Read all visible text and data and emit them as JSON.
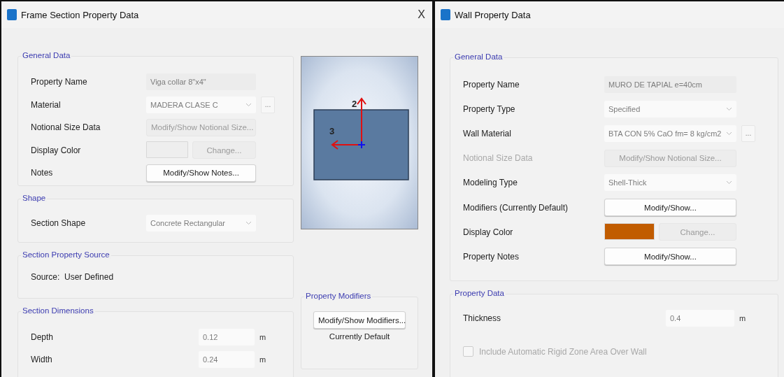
{
  "frame_dialog": {
    "title": "Frame Section Property Data",
    "close": "X",
    "general": {
      "legend": "General Data",
      "rows": [
        {
          "kind": "text",
          "label": "Property Name",
          "value": "Viga collar 8\"x4\"",
          "disabled": true
        },
        {
          "kind": "select",
          "label": "Material",
          "value": "MADERA CLASE C",
          "disabled": true,
          "more": "..."
        },
        {
          "kind": "button",
          "label": "Notional Size Data",
          "value": "Modify/Show Notional Size...",
          "disabled": true
        },
        {
          "kind": "color",
          "label": "Display Color",
          "color": "#eeeeee",
          "value": "Change...",
          "disabled": true
        },
        {
          "kind": "button",
          "label": "Notes",
          "value": "Modify/Show Notes...",
          "disabled": false
        }
      ]
    },
    "shape": {
      "legend": "Shape",
      "rows": [
        {
          "kind": "select",
          "label": "Section Shape",
          "value": "Concrete Rectangular",
          "disabled": true
        }
      ]
    },
    "source": {
      "legend": "Section Property Source",
      "text": "Source:  User Defined"
    },
    "dimensions": {
      "legend": "Section Dimensions",
      "rows": [
        {
          "label": "Depth",
          "value": "0.12",
          "unit": "m"
        },
        {
          "label": "Width",
          "value": "0.24",
          "unit": "m"
        }
      ]
    },
    "preview": {
      "axis_2": "2",
      "axis_3": "3"
    },
    "modifiers": {
      "legend": "Property Modifiers",
      "button": "Modify/Show Modifiers...",
      "status": "Currently Default"
    }
  },
  "wall_dialog": {
    "title": "Wall Property Data",
    "general": {
      "legend": "General Data",
      "rows": [
        {
          "kind": "text",
          "label": "Property Name",
          "value": "MURO DE TAPIAL e=40cm",
          "disabled": true,
          "label_disabled": false
        },
        {
          "kind": "select",
          "label": "Property Type",
          "value": "Specified",
          "disabled": true,
          "label_disabled": false
        },
        {
          "kind": "select",
          "label": "Wall Material",
          "value": "BTA CON 5% CaO fm= 8 kg/cm2",
          "disabled": true,
          "label_disabled": false,
          "more": "..."
        },
        {
          "kind": "button",
          "label": "Notional Size Data",
          "value": "Modify/Show Notional Size...",
          "disabled": true,
          "label_disabled": true
        },
        {
          "kind": "select",
          "label": "Modeling Type",
          "value": "Shell-Thick",
          "disabled": true,
          "label_disabled": false
        },
        {
          "kind": "button",
          "label": "Modifiers (Currently Default)",
          "value": "Modify/Show...",
          "disabled": false,
          "label_disabled": false
        },
        {
          "kind": "color",
          "label": "Display Color",
          "color": "#c15c00",
          "value": "Change...",
          "disabled": true,
          "label_disabled": false
        },
        {
          "kind": "button",
          "label": "Property Notes",
          "value": "Modify/Show...",
          "disabled": false,
          "label_disabled": false
        }
      ]
    },
    "property_data": {
      "legend": "Property Data",
      "rows": [
        {
          "label": "Thickness",
          "value": "0.4",
          "unit": "m"
        }
      ],
      "checkbox": {
        "label": "Include Automatic Rigid Zone Area Over Wall",
        "checked": false,
        "disabled": true
      }
    }
  }
}
